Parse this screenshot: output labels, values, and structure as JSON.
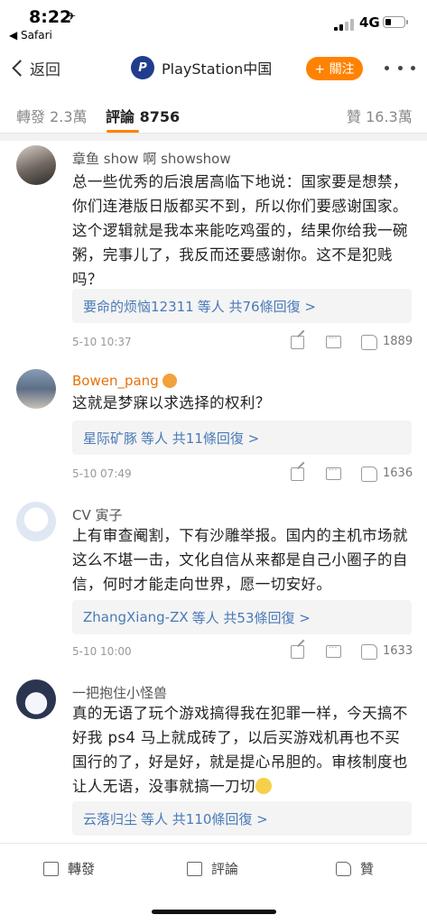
{
  "status_bar": {
    "time": "8:22",
    "location_glyph": "✈",
    "back_app": "◀ Safari",
    "network": "4G"
  },
  "nav": {
    "back_label": "返回",
    "title": "PlayStation中国",
    "logo_glyph": "P",
    "follow_label": "+ 關注"
  },
  "tabs": {
    "repost": "轉發 2.3萬",
    "comments": "評論 8756",
    "likes": "贊 16.3萬"
  },
  "comments": [
    {
      "user": "章鱼 show 啊 showshow",
      "text": "总一些优秀的后浪居高临下地说：国家要是想禁，你们连港版日版都买不到，所以你们要感谢国家。 这个逻辑就是我本来能吃鸡蛋的，结果你给我一碗粥，完事儿了，我反而还要感谢你。这不是犯贱吗？",
      "reply_who": "要命的烦恼12311",
      "reply_count": "等人 共76條回復 >",
      "date": "5-10 10:37",
      "likes": "1889"
    },
    {
      "user": "Bowen_pang",
      "text": "这就是梦寐以求选择的权利？",
      "reply_who": "星际矿豚",
      "reply_count": "等人 共11條回復 >",
      "date": "5-10 07:49",
      "likes": "1636"
    },
    {
      "user": "CV 寅子",
      "text": "上有审查阉割，下有沙雕举报。国内的主机市场就这么不堪一击，文化自信从来都是自己小圈子的自信，何时才能走向世界，愿一切安好。",
      "reply_who": "ZhangXiang-ZX",
      "reply_count": "等人 共53條回復 >",
      "date": "5-10 10:00",
      "likes": "1633"
    },
    {
      "user": "一把抱住小怪兽",
      "text": "真的无语了玩个游戏搞得我在犯罪一样，今天搞不好我 ps4 马上就成砖了，以后买游戏机再也不买国行的了，好是好，就是提心吊胆的。审核制度也让人无语，没事就搞一刀切",
      "reply_who": "云落归尘",
      "reply_count": "等人 共110條回復 >",
      "date": "",
      "likes": ""
    }
  ],
  "bottom_bar": {
    "repost": "轉發",
    "comment": "評論",
    "like": "贊"
  },
  "colors": {
    "accent": "#ff8200",
    "link": "#4a7ab7",
    "brand": "#1f3d8c"
  }
}
